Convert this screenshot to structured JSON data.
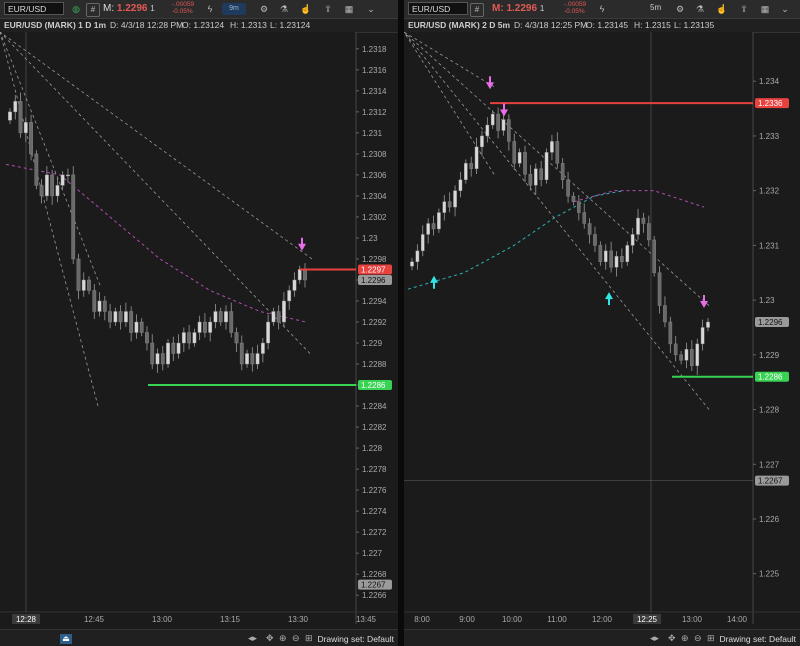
{
  "panes": [
    {
      "symbol": "EUR/USD",
      "mark_prefix": "M:",
      "mark_value": "1.2296",
      "mark_size": "1",
      "change_abs": "-.00059",
      "change_pct": "-0.05%",
      "timeframe_button": "9m",
      "header": {
        "title": "EUR/USD (MARK) 1 D 1m",
        "date": "D: 4/3/18 12:28 PM",
        "open": "O: 1.23124",
        "high": "H: 1.2313",
        "low": "L: 1.23124"
      },
      "drawing_set": "Drawing set: Default",
      "chart_data": {
        "type": "candlestick",
        "title": "EUR/USD (MARK) 1 D 1m",
        "ylim": [
          1.22644,
          1.23196
        ],
        "y_ticks": [
          "1.2318",
          "1.2316",
          "1.2314",
          "1.2312",
          "1.231",
          "1.2308",
          "1.2306",
          "1.2304",
          "1.2302",
          "1.23",
          "1.2298",
          "1.2296",
          "1.2294",
          "1.2292",
          "1.229",
          "1.2288",
          "1.2286",
          "1.2284",
          "1.2282",
          "1.228",
          "1.2278",
          "1.2276",
          "1.2274",
          "1.2272",
          "1.227",
          "1.2268",
          "1.2266"
        ],
        "x_ticks": [
          "12:28",
          "12:45",
          "13:00",
          "13:15",
          "13:30",
          "13:45"
        ],
        "price_labels": [
          {
            "text": "1.2297",
            "value": 1.2297,
            "color": "#e8423f"
          },
          {
            "text": "1.2296",
            "value": 1.2296,
            "color": "#9a9a9a"
          },
          {
            "text": "1.2286",
            "value": 1.2286,
            "color": "#39d353"
          },
          {
            "text": "1.2267",
            "value": 1.2267,
            "color": "#9a9a9a"
          }
        ],
        "levels": [
          {
            "name": "resistance",
            "value": 1.2297,
            "color": "#e8423f"
          },
          {
            "name": "support",
            "value": 1.2286,
            "color": "#39d353"
          }
        ],
        "closes": [
          1.2312,
          1.2313,
          1.231,
          1.2311,
          1.2308,
          1.2305,
          1.2304,
          1.2306,
          1.2304,
          1.2305,
          1.2306,
          1.2306,
          1.2298,
          1.2295,
          1.2296,
          1.2295,
          1.2293,
          1.2294,
          1.2293,
          1.2292,
          1.2293,
          1.2292,
          1.2293,
          1.2291,
          1.2292,
          1.2291,
          1.229,
          1.2288,
          1.2289,
          1.2288,
          1.229,
          1.2289,
          1.229,
          1.2291,
          1.229,
          1.2291,
          1.2292,
          1.2291,
          1.2292,
          1.2293,
          1.2292,
          1.2293,
          1.2291,
          1.229,
          1.2288,
          1.2289,
          1.2288,
          1.2289,
          1.229,
          1.2292,
          1.2293,
          1.2292,
          1.2294,
          1.2295,
          1.2296,
          1.2297,
          1.2296
        ]
      }
    },
    {
      "symbol": "EUR/USD",
      "mark_prefix": "M:",
      "mark_value": "1.2296",
      "mark_size": "1",
      "change_abs": "-.00059",
      "change_pct": "-0.05%",
      "timeframe_button": "5m",
      "header": {
        "title": "EUR/USD (MARK) 2 D 5m",
        "date": "D: 4/3/18 12:25 PM",
        "open": "O: 1.23145",
        "high": "H: 1.2315",
        "low": "L: 1.23135"
      },
      "drawing_set": "Drawing set: Default",
      "chart_data": {
        "type": "candlestick",
        "title": "EUR/USD (MARK) 2 D 5m",
        "ylim": [
          1.2243,
          1.2349
        ],
        "y_ticks": [
          "1.234",
          "1.233",
          "1.232",
          "1.231",
          "1.23",
          "1.229",
          "1.228",
          "1.227",
          "1.226",
          "1.225"
        ],
        "x_ticks": [
          "8:00",
          "9:00",
          "10:00",
          "11:00",
          "12:00",
          "12:25",
          "13:00",
          "14:00"
        ],
        "price_labels": [
          {
            "text": "1.2336",
            "value": 1.2336,
            "color": "#e8423f"
          },
          {
            "text": "1.2296",
            "value": 1.2296,
            "color": "#9a9a9a"
          },
          {
            "text": "1.2286",
            "value": 1.2286,
            "color": "#39d353"
          },
          {
            "text": "1.2267",
            "value": 1.2267,
            "color": "#9a9a9a"
          }
        ],
        "levels": [
          {
            "name": "resistance",
            "value": 1.2336,
            "color": "#e8423f"
          },
          {
            "name": "support",
            "value": 1.2286,
            "color": "#39d353"
          }
        ],
        "closes": [
          1.2307,
          1.2309,
          1.2312,
          1.2314,
          1.2313,
          1.2316,
          1.2318,
          1.2317,
          1.232,
          1.2322,
          1.2325,
          1.2324,
          1.2328,
          1.233,
          1.2332,
          1.2334,
          1.2331,
          1.2333,
          1.2329,
          1.2325,
          1.2327,
          1.2323,
          1.2321,
          1.2324,
          1.2322,
          1.2327,
          1.2329,
          1.2325,
          1.2322,
          1.2319,
          1.2318,
          1.2316,
          1.2314,
          1.2312,
          1.231,
          1.2307,
          1.2309,
          1.2306,
          1.2308,
          1.2307,
          1.231,
          1.2312,
          1.2315,
          1.2314,
          1.2311,
          1.2305,
          1.2299,
          1.2296,
          1.2292,
          1.229,
          1.2289,
          1.2291,
          1.2288,
          1.2292,
          1.2295,
          1.2296
        ]
      }
    }
  ]
}
